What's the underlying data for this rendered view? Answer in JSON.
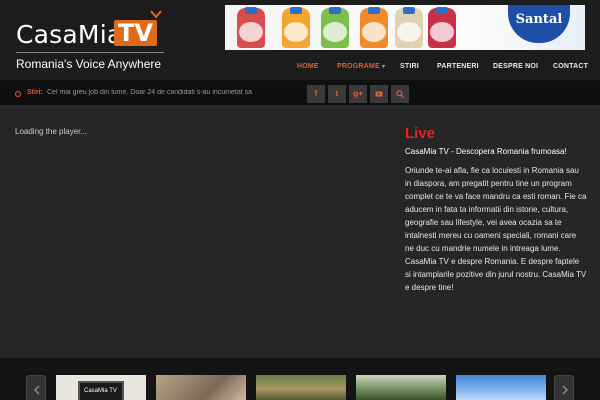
{
  "logo": {
    "casa": "CasaMia",
    "tv": "TV",
    "tagline": "Romania's Voice Anywhere"
  },
  "ad": {
    "brand": "Santal"
  },
  "nav": {
    "items": [
      "HOME",
      "PROGRAME",
      "STIRI",
      "PARTENERI",
      "DESPRE NOI",
      "CONTACT"
    ],
    "dropdown_caret": "▾"
  },
  "ticker": {
    "label": "Stiri:",
    "text": "Cel mai greu job din lume. Doar 24 de candidati s-au incumetat sa"
  },
  "social": {
    "facebook": "f",
    "twitter": "t",
    "googleplus": "g+"
  },
  "player": {
    "loading_text": "Loading the player..."
  },
  "live": {
    "title": "Live",
    "subtitle": "CasaMia TV - Descopera Romania frumoasa!",
    "description": "Oriunde te-ai afla, fie ca locuiesti in Romania sau in diaspora, am pregatit pentru tine un program complet ce te va face mandru ca esti roman. Fie ca aducem in fata ta informatii din istorie, cultura, geografie sau lifestyle, vei avea ocazia sa te intalnesti mereu cu oameni speciali, romani care ne duc cu mandrie numele in intreaga lume. CasaMia TV e despre Romania. E despre faptele si intamplarile pozitive din jurul nostru. CasaMia TV e despre tine!"
  },
  "carousel": {
    "thumb1_title": "CasaMia TV"
  },
  "colors": {
    "accent": "#e0602a",
    "live_red": "#e82020",
    "background": "#262626",
    "header": "#1c1c1c"
  },
  "icons": [
    "facebook-icon",
    "twitter-icon",
    "googleplus-icon",
    "youtube-icon",
    "search-icon",
    "chevron-left-icon",
    "chevron-right-icon",
    "ticker-dot-icon"
  ]
}
